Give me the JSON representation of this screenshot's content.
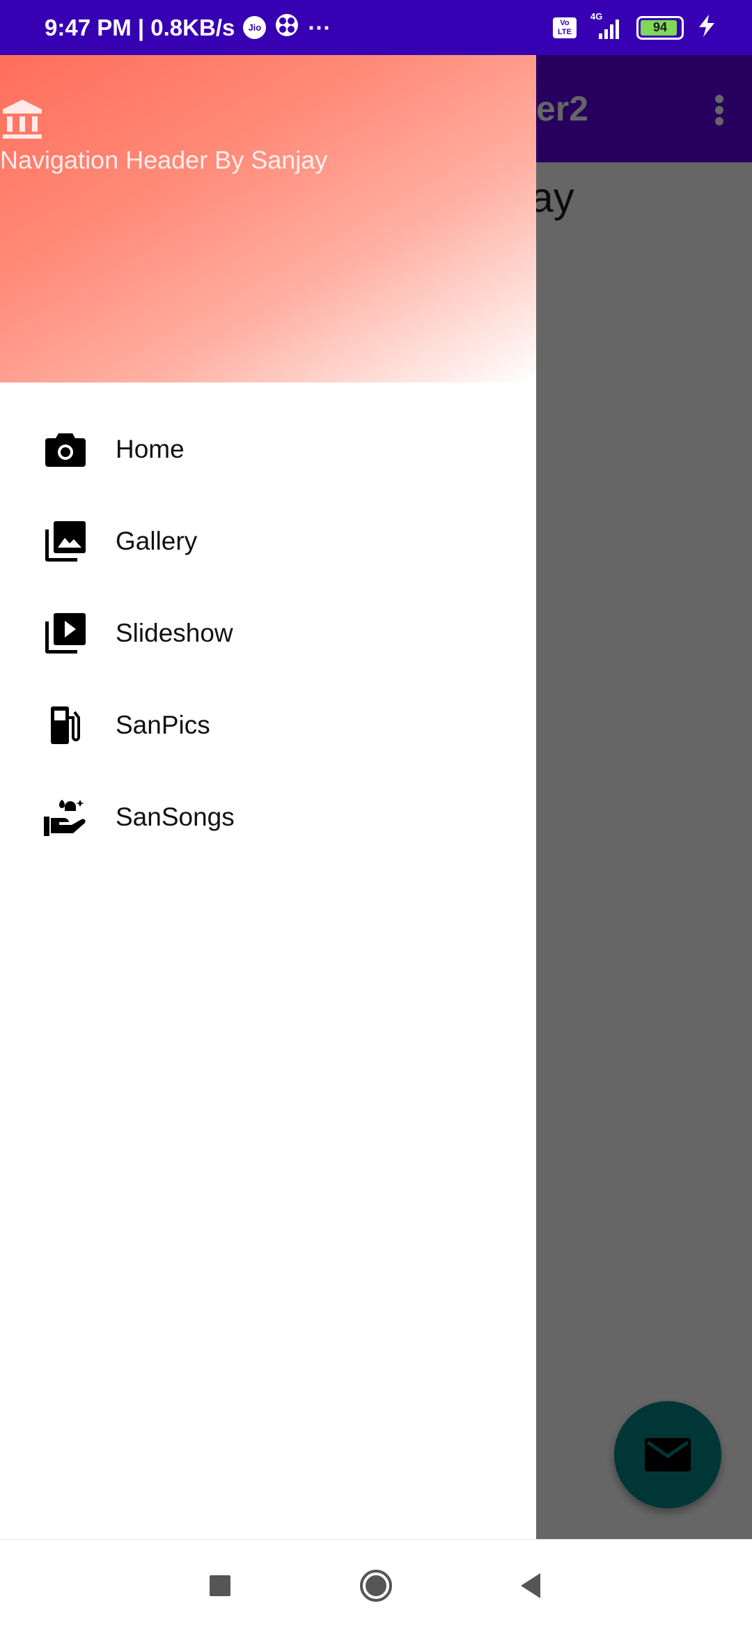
{
  "status_bar": {
    "time_speed": "9:47 PM | 0.8KB/s",
    "jio_label": "Jio",
    "more": "···",
    "volte_top": "Vo",
    "volte_bottom": "LTE",
    "network": "4G",
    "battery": "94",
    "battery_level": 0.94
  },
  "app": {
    "title": "er2",
    "content_text": "jay"
  },
  "drawer": {
    "header_title": "Navigation Header By Sanjay",
    "items": [
      {
        "label": "Home",
        "icon": "camera-icon"
      },
      {
        "label": "Gallery",
        "icon": "photo-library-icon"
      },
      {
        "label": "Slideshow",
        "icon": "slideshow-icon"
      },
      {
        "label": "SanPics",
        "icon": "fuel-pump-icon"
      },
      {
        "label": "SanSongs",
        "icon": "clean-hands-icon"
      }
    ]
  },
  "colors": {
    "status_bar": "#3700b3",
    "app_bar": "#6200ee",
    "fab": "#018786",
    "header_gradient_start": "#ff6e5a"
  }
}
